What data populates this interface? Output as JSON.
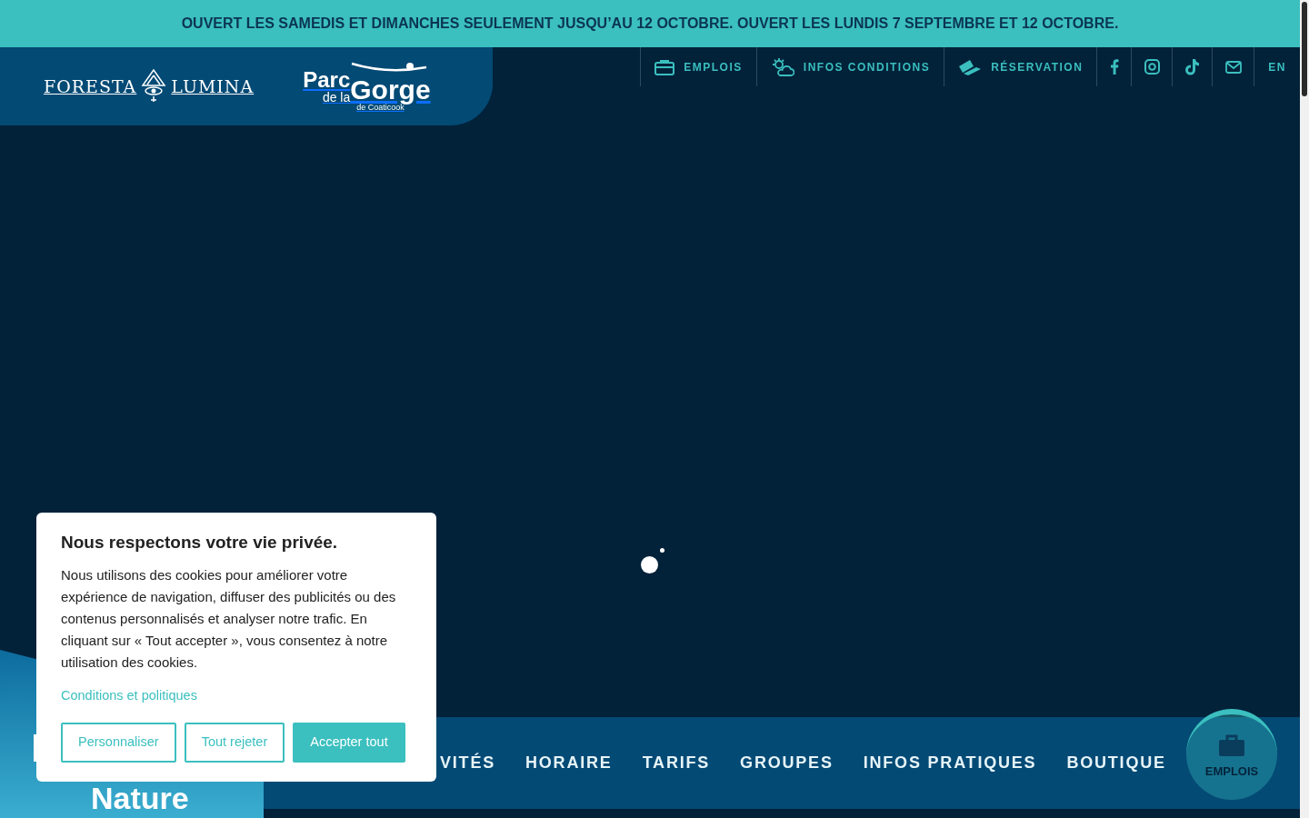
{
  "banner": {
    "text": "OUVERT LES SAMEDIS ET DIMANCHES SEULEMENT JUSQU’AU 12 OCTOBRE. OUVERT LES LUNDIS 7 SEPTEMBRE ET 12 OCTOBRE."
  },
  "logos": {
    "foresta": {
      "left": "FORESTA",
      "right": "LUMINA"
    },
    "parc": {
      "line1": "Parc",
      "line2": "de la",
      "line3": "Gorge",
      "line4": "de Coaticook"
    }
  },
  "top_nav": [
    {
      "kind": "labeled",
      "label": "EMPLOIS"
    },
    {
      "kind": "labeled",
      "label": "INFOS CONDITIONS"
    },
    {
      "kind": "labeled",
      "label": "RÉSERVATION"
    },
    {
      "kind": "icon"
    },
    {
      "kind": "icon"
    },
    {
      "kind": "icon"
    },
    {
      "kind": "icon"
    },
    {
      "kind": "language",
      "label": "EN"
    }
  ],
  "hero": {
    "title": "Nature"
  },
  "main_nav": [
    "VITÉS",
    "HORAIRE",
    "TARIFS",
    "GROUPES",
    "INFOS PRATIQUES",
    "BOUTIQUE"
  ],
  "floating_button": {
    "label": "EMPLOIS"
  },
  "cookie_dialog": {
    "title": "Nous respectons votre vie privée.",
    "body": "Nous utilisons des cookies pour améliorer votre expérience de navigation, diffuser des publicités ou des contenus personnalisés et analyser notre trafic. En cliquant sur « Tout accepter », vous consentez à notre utilisation des cookies.",
    "link": "Conditions et politiques",
    "buttons": [
      {
        "label": "Personnaliser",
        "kind": "outline"
      },
      {
        "label": "Tout rejeter",
        "kind": "outline"
      },
      {
        "label": "Accepter tout",
        "kind": "solid"
      }
    ]
  }
}
